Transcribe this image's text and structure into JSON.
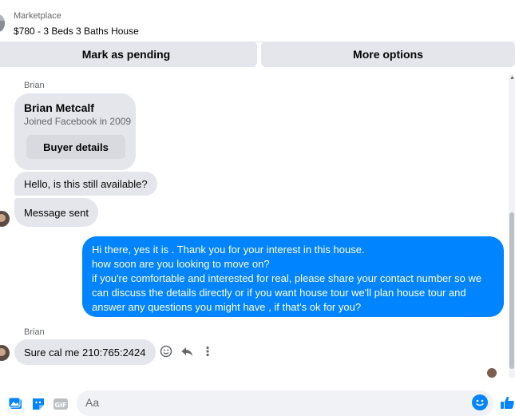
{
  "header": {
    "category": "Marketplace",
    "listing_title": "$780 - 3 Beds 3 Baths House"
  },
  "actions": {
    "mark_pending": "Mark as pending",
    "more_options": "More options"
  },
  "conversation": {
    "sender_name_1": "Brian",
    "buyer_card": {
      "name": "Brian Metcalf",
      "subtitle": "Joined Facebook in 2009",
      "button": "Buyer details"
    },
    "msg_available": "Hello, is this still available?",
    "msg_sent": "Message sent",
    "reply_lines": [
      "Hi there, yes it is . Thank you for your interest in this house.",
      "how soon are you looking to move on?",
      "if you're comfortable and interested for real, please share your contact number so we",
      "can discuss the details directly or if you  want house tour we'll plan house tour and",
      "answer any questions you might have , if that's ok for you?"
    ],
    "sender_name_2": "Brian",
    "msg_phone": "Sure cal me 210:765:2424"
  },
  "composer": {
    "placeholder": "Aa"
  },
  "colors": {
    "accent": "#0084ff",
    "bubble_grey": "#e4e6eb",
    "button_grey": "#e4e6eb"
  },
  "icons": {
    "header": "listing-thumbnail",
    "msg_actions": [
      "react-icon",
      "reply-icon",
      "more-icon"
    ],
    "composer": [
      "photo-icon",
      "sticker-icon",
      "gif-icon",
      "emoji-icon",
      "thumbs-up-icon"
    ]
  }
}
